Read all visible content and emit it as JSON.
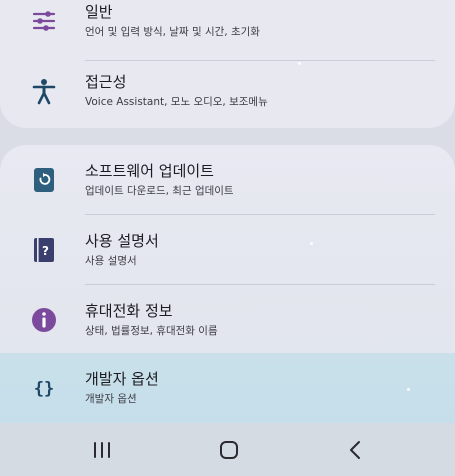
{
  "group_top": {
    "items": [
      {
        "title": "일반",
        "subtitle": "언어 및 입력 방식, 날짜 및 시간, 초기화",
        "icon": "sliders-icon"
      },
      {
        "title": "접근성",
        "subtitle": "Voice Assistant, 모노 오디오, 보조메뉴",
        "icon": "accessibility-icon"
      }
    ]
  },
  "group_bottom": {
    "items": [
      {
        "title": "소프트웨어 업데이트",
        "subtitle": "업데이트 다운로드, 최근 업데이트",
        "icon": "software-update-icon"
      },
      {
        "title": "사용 설명서",
        "subtitle": "사용 설명서",
        "icon": "user-manual-icon"
      },
      {
        "title": "휴대전화 정보",
        "subtitle": "상태, 법률정보, 휴대전화 이름",
        "icon": "info-icon"
      },
      {
        "title": "개발자 옵션",
        "subtitle": "개발자 옵션",
        "icon": "developer-options-icon"
      }
    ]
  },
  "navbar": {
    "recents": "recents-icon",
    "home": "home-icon",
    "back": "back-icon"
  },
  "colors": {
    "general_icon": "#7b4a9c",
    "accessibility_icon": "#1f4766",
    "update_icon": "#2f5f7e",
    "manual_icon": "#3a3f6e",
    "info_icon": "#7b4a9c",
    "developer_icon": "#1f4766",
    "highlight": "#c6e0ea"
  }
}
